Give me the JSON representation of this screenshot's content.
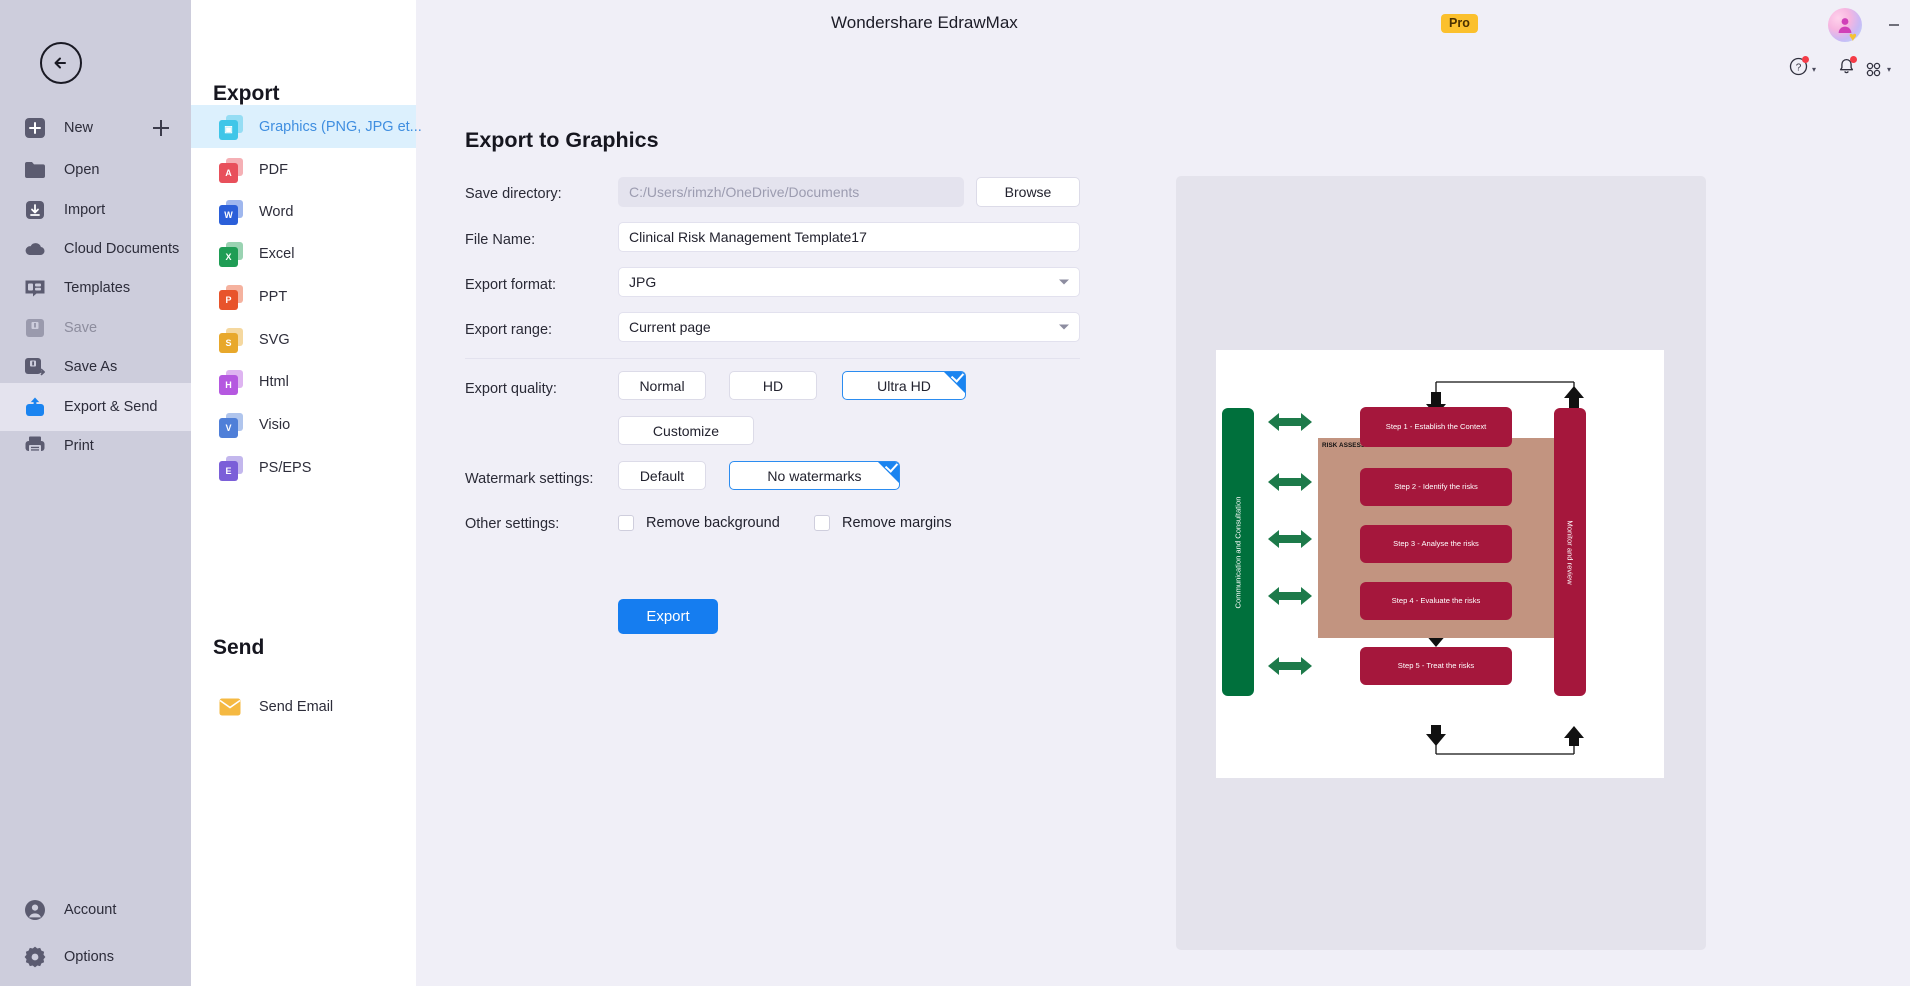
{
  "titlebar": {
    "app_title": "Wondershare EdrawMax",
    "pro_badge": "Pro",
    "avatar_icon": "user-avatar-icon",
    "minimize_icon": "minimize-icon",
    "maximize_icon": "maximize-restore-icon",
    "close_icon": "close-icon",
    "tools": [
      {
        "name": "help-icon",
        "caret": "▾"
      },
      {
        "name": "notifications-bell-icon",
        "caret": ""
      },
      {
        "name": "apps-grid-icon",
        "caret": "▾"
      },
      {
        "name": "theme-shirt-icon",
        "caret": "▾"
      },
      {
        "name": "settings-gear-icon",
        "caret": ""
      }
    ]
  },
  "leftnav": {
    "back_icon": "back-arrow-icon",
    "add_icon": "plus-icon",
    "items": [
      {
        "label": "New",
        "icon": "new-document-icon",
        "state": "normal"
      },
      {
        "label": "Open",
        "icon": "folder-open-icon",
        "state": "normal"
      },
      {
        "label": "Import",
        "icon": "import-download-icon",
        "state": "normal"
      },
      {
        "label": "Cloud Documents",
        "icon": "cloud-icon",
        "state": "normal"
      },
      {
        "label": "Templates",
        "icon": "templates-icon",
        "state": "normal"
      },
      {
        "label": "Save",
        "icon": "save-disk-icon",
        "state": "disabled"
      },
      {
        "label": "Save As",
        "icon": "save-as-icon",
        "state": "normal"
      },
      {
        "label": "Export & Send",
        "icon": "export-share-icon",
        "state": "active"
      },
      {
        "label": "Print",
        "icon": "printer-icon",
        "state": "normal"
      }
    ],
    "bottom_items": [
      {
        "label": "Account",
        "icon": "account-user-icon"
      },
      {
        "label": "Options",
        "icon": "options-gear-icon"
      }
    ]
  },
  "export_panel": {
    "heading": "Export",
    "formats": [
      {
        "label": "Graphics (PNG, JPG et...",
        "icon": "image-file-icon",
        "color": "#3fc6e8",
        "glyph": "☑",
        "selected": true
      },
      {
        "label": "PDF",
        "icon": "pdf-file-icon",
        "color": "#e8505b",
        "glyph": "A",
        "selected": false
      },
      {
        "label": "Word",
        "icon": "word-file-icon",
        "color": "#2b5fd9",
        "glyph": "W",
        "selected": false
      },
      {
        "label": "Excel",
        "icon": "excel-file-icon",
        "color": "#1f9d55",
        "glyph": "X",
        "selected": false
      },
      {
        "label": "PPT",
        "icon": "ppt-file-icon",
        "color": "#e8542b",
        "glyph": "P",
        "selected": false
      },
      {
        "label": "SVG",
        "icon": "svg-file-icon",
        "color": "#e8a82b",
        "glyph": "S",
        "selected": false
      },
      {
        "label": "Html",
        "icon": "html-file-icon",
        "color": "#b558e0",
        "glyph": "H",
        "selected": false
      },
      {
        "label": "Visio",
        "icon": "visio-file-icon",
        "color": "#4f7fd8",
        "glyph": "V",
        "selected": false
      },
      {
        "label": "PS/EPS",
        "icon": "ps-eps-file-icon",
        "color": "#7b5fd8",
        "glyph": "E",
        "selected": false
      }
    ],
    "send_heading": "Send",
    "send_items": [
      {
        "label": "Send Email",
        "icon": "email-envelope-icon"
      }
    ]
  },
  "form": {
    "title": "Export to Graphics",
    "save_directory_label": "Save directory:",
    "save_directory_value": "C:/Users/rimzh/OneDrive/Documents",
    "browse_label": "Browse",
    "file_name_label": "File Name:",
    "file_name_value": "Clinical Risk Management Template17",
    "export_format_label": "Export format:",
    "export_format_value": "JPG",
    "export_range_label": "Export range:",
    "export_range_value": "Current page",
    "export_quality_label": "Export quality:",
    "quality_options": [
      {
        "label": "Normal",
        "selected": false
      },
      {
        "label": "HD",
        "selected": false
      },
      {
        "label": "Ultra HD",
        "selected": true
      }
    ],
    "customize_label": "Customize",
    "watermark_label": "Watermark settings:",
    "watermark_options": [
      {
        "label": "Default",
        "selected": false
      },
      {
        "label": "No watermarks",
        "selected": true
      }
    ],
    "other_settings_label": "Other settings:",
    "checkboxes": [
      {
        "label": "Remove background",
        "checked": false
      },
      {
        "label": "Remove margins",
        "checked": false
      }
    ],
    "export_button_label": "Export"
  },
  "preview": {
    "diagram": {
      "left_band_label": "Communication and Consultation",
      "left_band_color": "#00703C",
      "right_band_label": "Monitor and review",
      "right_band_color": "#A5173C",
      "group_label": "RISK ASSESSMENT",
      "group_color": "#c29480",
      "step_color": "#A5173C",
      "arrow_color": "#1d7a4a",
      "steps": [
        "Step 1 - Establish the Context",
        "Step 2 - Identify  the risks",
        "Step 3 - Analyse the risks",
        "Step 4 - Evaluate the risks",
        "Step 5 - Treat the risks"
      ]
    }
  }
}
